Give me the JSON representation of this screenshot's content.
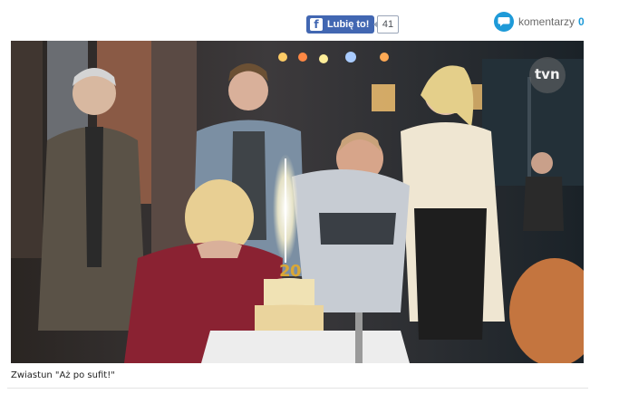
{
  "social": {
    "like_label": "Lubię to!",
    "like_icon": "facebook-icon",
    "like_count": "41",
    "comments_label": "komentarzy",
    "comments_count": "0",
    "comments_icon": "speech-bubble-icon",
    "accent": "#1e9ad8",
    "facebook_blue": "#4267b2"
  },
  "video": {
    "watermark": "tvn"
  },
  "caption": "Zwiastun \"Aż po sufit!\""
}
